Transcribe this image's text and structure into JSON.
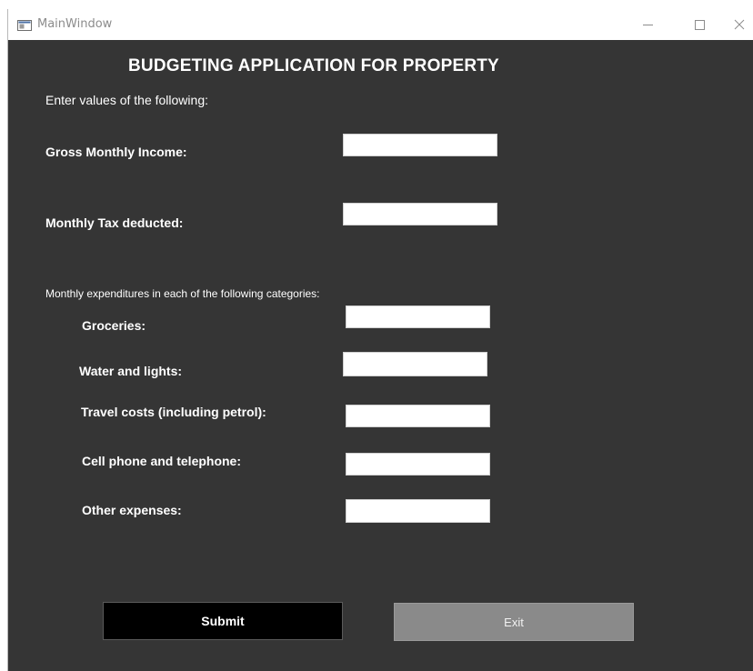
{
  "window": {
    "title": "MainWindow",
    "controls": {
      "minimize_icon": "minimize-icon",
      "maximize_icon": "maximize-icon",
      "close_icon": "close-icon"
    }
  },
  "form": {
    "heading": "BUDGETING APPLICATION FOR PROPERTY",
    "instructions": "Enter values of the following:",
    "gross_income_label": "Gross Monthly Income:",
    "gross_income_value": "",
    "tax_label": "Monthly Tax deducted:",
    "tax_value": "",
    "expenditures_caption": "Monthly expenditures in each of the following categories:",
    "expenses": [
      {
        "label": "Groceries:",
        "value": ""
      },
      {
        "label": "Water and lights:",
        "value": ""
      },
      {
        "label": "Travel costs (including petrol):",
        "value": ""
      },
      {
        "label": "Cell phone and telephone:",
        "value": ""
      },
      {
        "label": "Other expenses:",
        "value": ""
      }
    ]
  },
  "buttons": {
    "submit_label": "Submit",
    "exit_label": "Exit"
  },
  "colors": {
    "client_background": "#353535",
    "submit_background": "#000000",
    "exit_background": "#8a8a8a",
    "text": "#ffffff"
  }
}
